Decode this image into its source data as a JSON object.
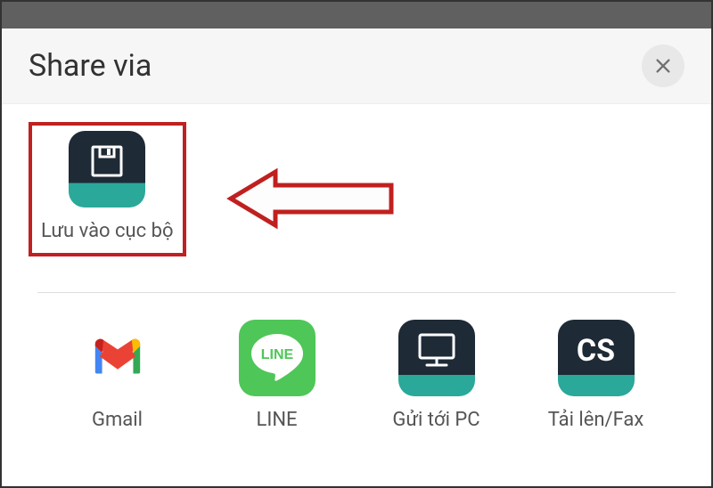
{
  "header": {
    "title": "Share via"
  },
  "highlighted": {
    "label": "Lưu vào cục bộ"
  },
  "apps": {
    "gmail": {
      "label": "Gmail"
    },
    "line": {
      "label": "LINE"
    },
    "pc": {
      "label": "Gửi tới PC"
    },
    "fax": {
      "label": "Tải lên/Fax",
      "badge": "CS"
    }
  },
  "colors": {
    "highlight_border": "#c02020",
    "icon_dark": "#1e2a35",
    "icon_teal": "#2aa89a",
    "line_green": "#4fc658"
  }
}
